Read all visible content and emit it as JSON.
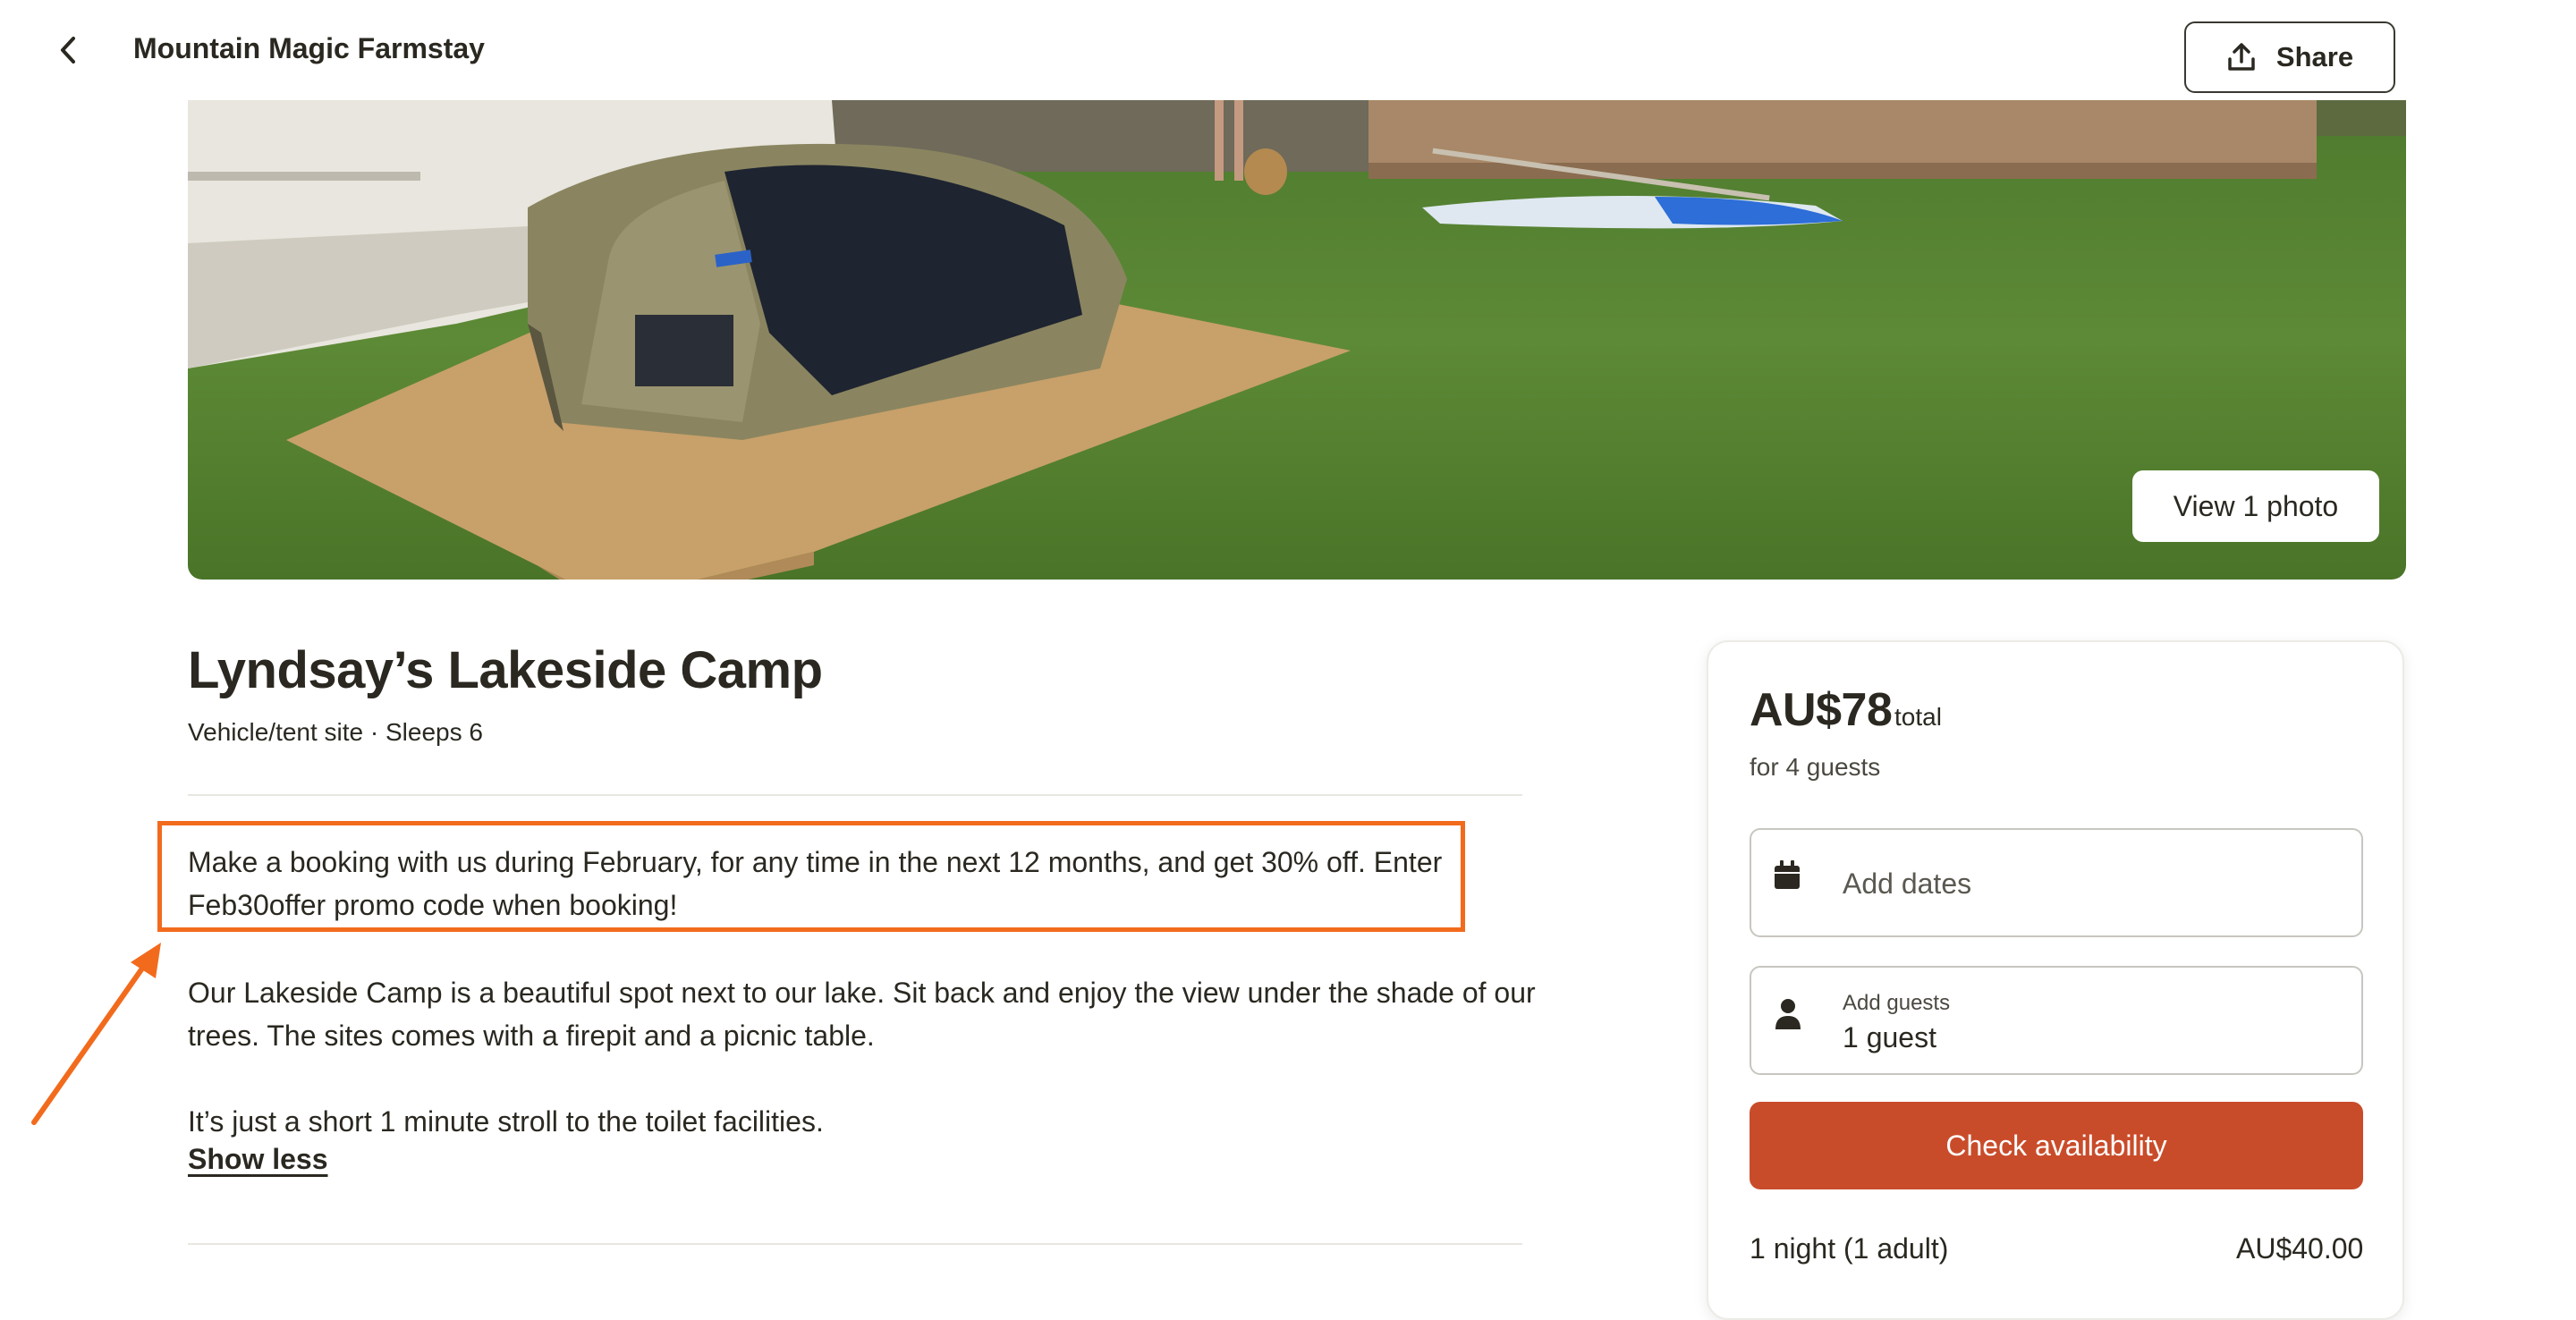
{
  "header": {
    "back_icon": "chevron-left-icon",
    "title": "Mountain Magic Farmstay",
    "share_label": "Share",
    "share_icon": "share-upload-icon"
  },
  "hero": {
    "view_photo_label": "View 1 photo"
  },
  "listing": {
    "title": "Lyndsay’s Lakeside Camp",
    "subtitle": "Vehicle/tent site · Sleeps 6",
    "promo_line1": "Make a booking with us during February, for any time in the next 12 months, and get 30% off. Enter",
    "promo_line2": "Feb30offer promo code when booking!",
    "description_line1": "Our Lakeside Camp is a beautiful spot next to our lake. Sit back and enjoy the view under the shade of our",
    "description_line2": "trees. The sites comes with a firepit and a picnic table.",
    "description_line3": "It’s just a short 1 minute stroll to the toilet facilities.",
    "show_less_label": "Show less"
  },
  "booking": {
    "price": "AU$78",
    "price_unit": "total",
    "price_guests": "for 4 guests",
    "dates_placeholder": "Add dates",
    "guests_label": "Add guests",
    "guests_value": "1 guest",
    "check_label": "Check availability",
    "night_label": "1 night (1 adult)",
    "night_price": "AU$40.00"
  },
  "colors": {
    "accent_button": "#c94c2a",
    "annotation": "#f26b1d",
    "text": "#2a2820"
  }
}
